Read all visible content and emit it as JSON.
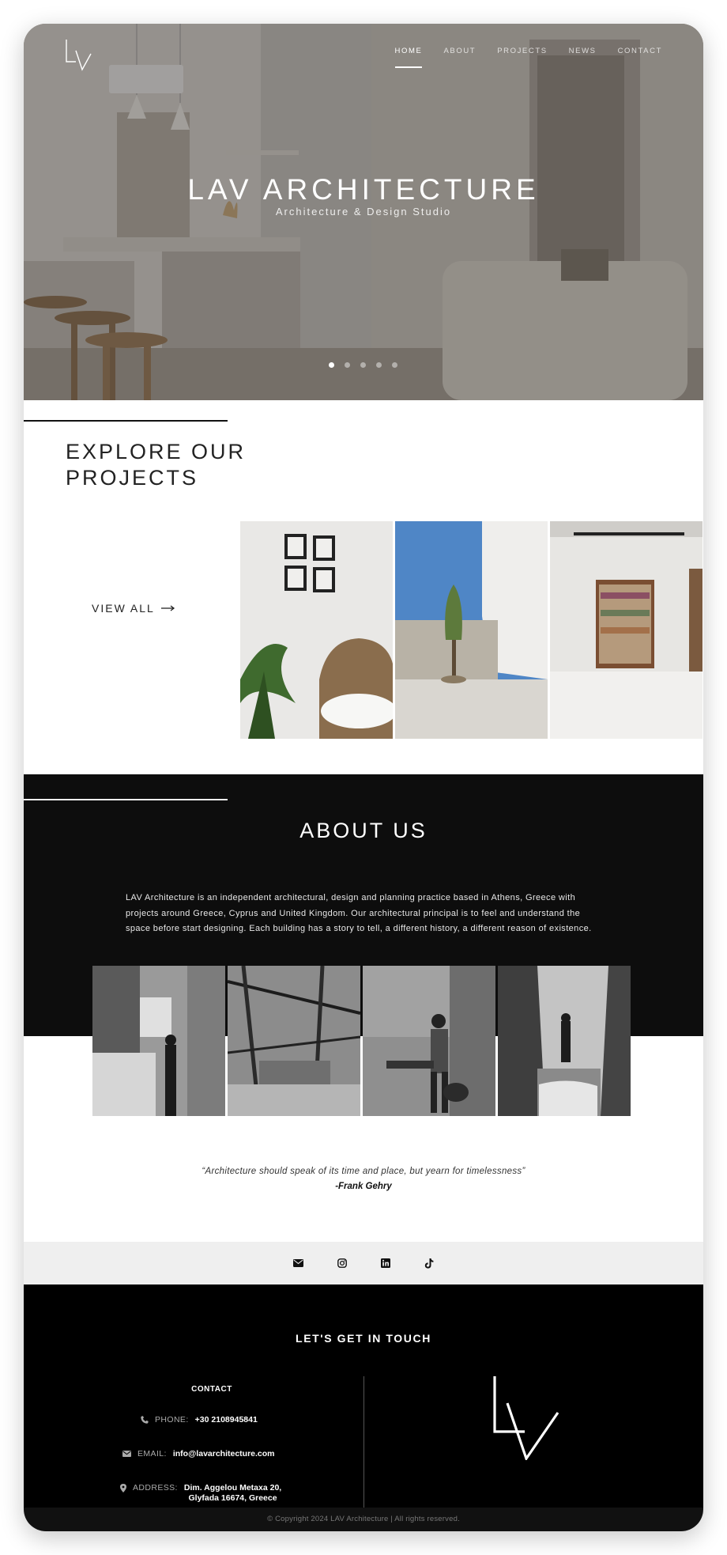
{
  "nav": {
    "items": [
      {
        "label": "HOME"
      },
      {
        "label": "ABOUT"
      },
      {
        "label": "PROJECTS"
      },
      {
        "label": "NEWS"
      },
      {
        "label": "CONTACT"
      }
    ],
    "active_index": 0
  },
  "hero": {
    "title": "LAV ARCHITECTURE",
    "subtitle": "Architecture & Design Studio",
    "slide_count": 5,
    "active_slide": 1
  },
  "explore": {
    "title_line1": "EXPLORE OUR",
    "title_line2": "PROJECTS",
    "view_all_label": "VIEW ALL",
    "view_all_icon": "arrow-right-icon"
  },
  "about": {
    "title": "ABOUT US",
    "text": "LAV Architecture is an independent architectural, design and planning practice based in Athens, Greece with projects around Greece, Cyprus and United Kingdom. Our architectural principal is to feel and understand the space before start designing. Each building has a story to tell, a different history, a different reason of existence."
  },
  "quote": {
    "text": "“Architecture should speak of its time and place, but yearn for timelessness”",
    "author": "-Frank Gehry"
  },
  "social": {
    "icons": [
      "envelope-icon",
      "instagram-icon",
      "linkedin-icon",
      "tiktok-icon"
    ]
  },
  "footer": {
    "heading": "LET'S GET IN TOUCH",
    "contact_heading": "CONTACT",
    "phone_label": "PHONE:",
    "phone_value": "+30 2108945841",
    "email_label": "EMAIL:",
    "email_value": "info@lavarchitecture.com",
    "address_label": "ADDRESS:",
    "address_line1": "Dim. Aggelou Metaxa 20,",
    "address_line2": "Glyfada 16674, Greece",
    "copyright": "© Copyright 2024  LAV Architecture | All rights reserved."
  },
  "colors": {
    "dark": "#0d0d0d",
    "footer": "#000000",
    "social_bar": "#efefef",
    "text": "#222222"
  }
}
